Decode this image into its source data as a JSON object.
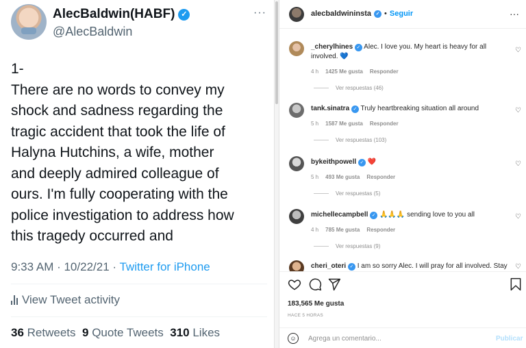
{
  "twitter": {
    "name": "AlecBaldwin(HABF)",
    "handle": "@AlecBaldwin",
    "more": "···",
    "tweet_lines": [
      "1-",
      "There are no words to convey my",
      "shock and sadness regarding the",
      "tragic accident that took the life of",
      "Halyna Hutchins, a wife, mother",
      "and deeply admired colleague of",
      "ours. I'm fully cooperating with the",
      "police investigation to address how",
      "this tragedy occurred and"
    ],
    "time": "9:33 AM · 10/22/21 · ",
    "source": "Twitter for iPhone",
    "activity": "View Tweet activity",
    "retweets_count": "36",
    "retweets_label": "Retweets",
    "quotes_count": "9",
    "quotes_label": "Quote Tweets",
    "likes_count": "310",
    "likes_label": "Likes"
  },
  "instagram": {
    "username": "alecbaldwininsta",
    "dot": "•",
    "follow": "Seguir",
    "more": "···",
    "comments": [
      {
        "user": "_cherylhines",
        "text": "Alec. I love you. My heart is heavy for all involved. 💙",
        "age": "4 h",
        "likes": "1425 Me gusta",
        "reply": "Responder",
        "replies": "Ver respuestas (46)"
      },
      {
        "user": "tank.sinatra",
        "text": "Truly heartbreaking situation all around",
        "age": "5 h",
        "likes": "1587 Me gusta",
        "reply": "Responder",
        "replies": "Ver respuestas (103)"
      },
      {
        "user": "bykeithpowell",
        "text": "❤️",
        "age": "5 h",
        "likes": "493 Me gusta",
        "reply": "Responder",
        "replies": "Ver respuestas (5)"
      },
      {
        "user": "michellecampbell",
        "text": "🙏🙏🙏 sending love to you all",
        "age": "4 h",
        "likes": "785 Me gusta",
        "reply": "Responder",
        "replies": "Ver respuestas (9)"
      },
      {
        "user": "cheri_oteri",
        "text": "I am so sorry Alec. I will pray for all involved. Stay"
      }
    ],
    "likes": "183,565 Me gusta",
    "time": "HACE 5 HORAS",
    "placeholder": "Agrega un comentario...",
    "publish": "Publicar"
  }
}
